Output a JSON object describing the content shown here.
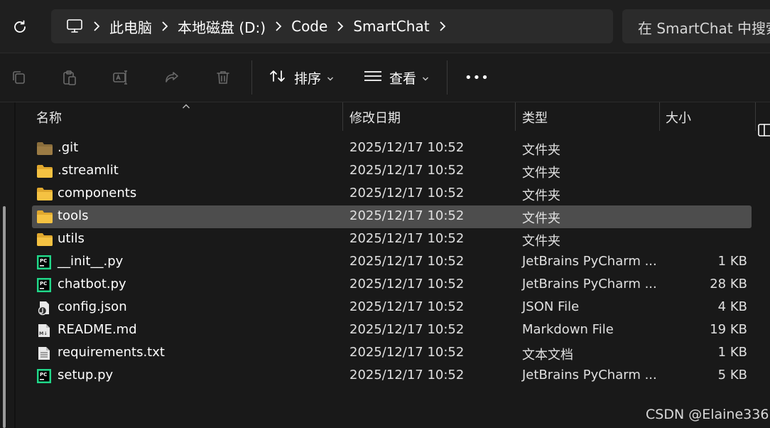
{
  "address_bar": {
    "breadcrumbs": [
      "此电脑",
      "本地磁盘 (D:)",
      "Code",
      "SmartChat"
    ],
    "search_placeholder": "在 SmartChat 中搜索"
  },
  "toolbar": {
    "sort_label": "排序",
    "view_label": "查看",
    "more_label": "•••"
  },
  "columns": {
    "name": "名称",
    "modified": "修改日期",
    "type": "类型",
    "size": "大小"
  },
  "files": [
    {
      "name": ".git",
      "modified": "2025/12/17 10:52",
      "type": "文件夹",
      "size": "",
      "icon": "folder-dark-icon"
    },
    {
      "name": ".streamlit",
      "modified": "2025/12/17 10:52",
      "type": "文件夹",
      "size": "",
      "icon": "folder-icon"
    },
    {
      "name": "components",
      "modified": "2025/12/17 10:52",
      "type": "文件夹",
      "size": "",
      "icon": "folder-icon"
    },
    {
      "name": "tools",
      "modified": "2025/12/17 10:52",
      "type": "文件夹",
      "size": "",
      "icon": "folder-icon",
      "selected": true
    },
    {
      "name": "utils",
      "modified": "2025/12/17 10:52",
      "type": "文件夹",
      "size": "",
      "icon": "folder-icon"
    },
    {
      "name": "__init__.py",
      "modified": "2025/12/17 10:52",
      "type": "JetBrains PyCharm ...",
      "size": "1 KB",
      "icon": "pycharm-file-icon"
    },
    {
      "name": "chatbot.py",
      "modified": "2025/12/17 10:52",
      "type": "JetBrains PyCharm ...",
      "size": "28 KB",
      "icon": "pycharm-file-icon"
    },
    {
      "name": "config.json",
      "modified": "2025/12/17 10:52",
      "type": "JSON File",
      "size": "4 KB",
      "icon": "json-file-icon"
    },
    {
      "name": "README.md",
      "modified": "2025/12/17 10:52",
      "type": "Markdown File",
      "size": "19 KB",
      "icon": "markdown-file-icon"
    },
    {
      "name": "requirements.txt",
      "modified": "2025/12/17 10:52",
      "type": "文本文档",
      "size": "1 KB",
      "icon": "text-file-icon"
    },
    {
      "name": "setup.py",
      "modified": "2025/12/17 10:52",
      "type": "JetBrains PyCharm ...",
      "size": "5 KB",
      "icon": "pycharm-file-icon"
    }
  ],
  "watermark": "CSDN @Elaine336",
  "colors": {
    "background": "#191919",
    "selection": "#4d4d4d",
    "folder": "#f5c242",
    "folder_dark": "#8a6d3b",
    "pycharm_green": "#21d789"
  }
}
